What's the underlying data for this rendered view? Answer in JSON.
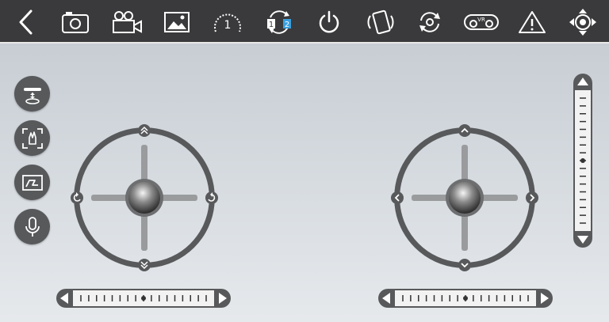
{
  "topbar": {
    "icons": [
      "back-icon",
      "camera-icon",
      "video-camera-icon",
      "gallery-icon",
      "speed-gauge-icon",
      "camera-switch-icon",
      "power-icon",
      "phone-tilt-icon",
      "rotate-icon",
      "vr-icon",
      "warning-icon",
      "gimbal-control-icon"
    ],
    "speed_level": "1",
    "switch_label_1": "1",
    "switch_label_2": "2",
    "vr_label": "VR"
  },
  "sidebar": {
    "icons": [
      "takeoff-landing-icon",
      "gesture-icon",
      "trajectory-icon",
      "microphone-icon"
    ]
  },
  "colors": {
    "topbar_bg": "#3a3a3c",
    "control_dark": "#58595b",
    "control_mid": "#9a9b9d",
    "accent_blue": "#3aa0e0"
  },
  "sliders": {
    "left_trim_position": 0.5,
    "right_trim_position": 0.5,
    "vertical_trim_position": 0.5
  }
}
